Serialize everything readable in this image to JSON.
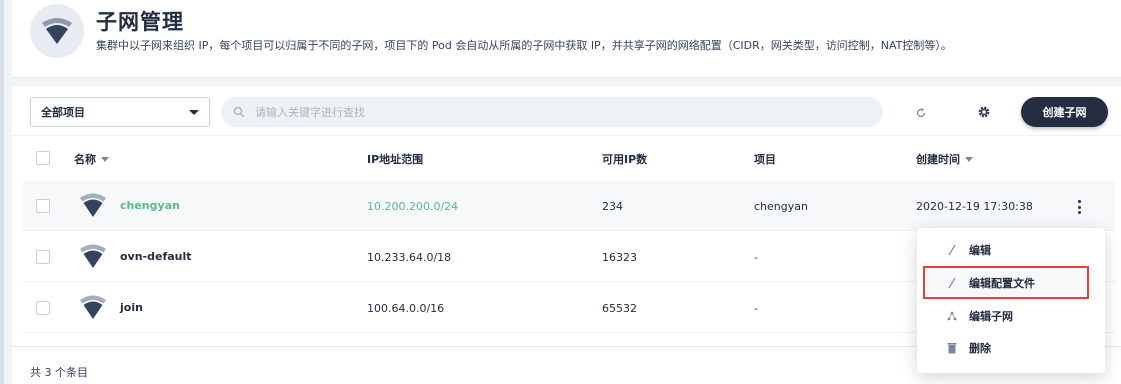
{
  "header": {
    "title": "子网管理",
    "description": "集群中以子网来组织 IP，每个项目可以归属于不同的子网，项目下的 Pod 会自动从所属的子网中获取 IP，并共享子网的网络配置（CIDR，网关类型，访问控制，NAT控制等）。"
  },
  "toolbar": {
    "project_select": "全部项目",
    "search_placeholder": "请输入关键字进行查找",
    "create_label": "创建子网"
  },
  "table": {
    "columns": [
      "名称",
      "IP地址范围",
      "可用IP数",
      "项目",
      "创建时间"
    ],
    "rows": [
      {
        "name": "chengyan",
        "ip_range": "10.200.200.0/24",
        "available": "234",
        "project": "chengyan",
        "created": "2020-12-19 17:30:38"
      },
      {
        "name": "ovn-default",
        "ip_range": "10.233.64.0/18",
        "available": "16323",
        "project": "-",
        "created": ""
      },
      {
        "name": "join",
        "ip_range": "100.64.0.0/16",
        "available": "65532",
        "project": "-",
        "created": ""
      }
    ]
  },
  "footer": {
    "count_text": "共 3 个条目"
  },
  "menu": {
    "items": [
      {
        "label": "编辑",
        "icon": "pencil-icon"
      },
      {
        "label": "编辑配置文件",
        "icon": "pencil-icon"
      },
      {
        "label": "编辑子网",
        "icon": "topology-icon"
      },
      {
        "label": "删除",
        "icon": "trash-icon"
      }
    ]
  },
  "colors": {
    "accent_dark": "#242e42",
    "green": "#55bc8a",
    "highlight_border": "#e0413a"
  }
}
